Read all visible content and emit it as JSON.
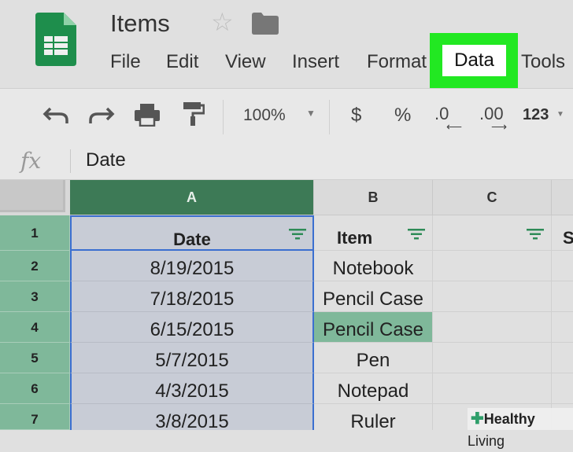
{
  "doc": {
    "title": "Items"
  },
  "menu": [
    "File",
    "Edit",
    "View",
    "Insert",
    "Format",
    "Data",
    "Tools"
  ],
  "toolbar": {
    "zoom": "100%",
    "currency": "$",
    "percent": "%",
    "dec_decrease": ".0",
    "dec_increase": ".00",
    "format_more": "123"
  },
  "formula_bar": {
    "fx": "fx",
    "value": "Date"
  },
  "columns": [
    "A",
    "B",
    "C"
  ],
  "rows": [
    "1",
    "2",
    "3",
    "4",
    "5",
    "6",
    "7"
  ],
  "headers": {
    "a": "Date",
    "b": "Item",
    "d_partial": "S"
  },
  "data": [
    {
      "date": "8/19/2015",
      "item": "Notebook"
    },
    {
      "date": "7/18/2015",
      "item": "Pencil Case"
    },
    {
      "date": "6/15/2015",
      "item": "Pencil Case"
    },
    {
      "date": "5/7/2015",
      "item": "Pen"
    },
    {
      "date": "4/3/2015",
      "item": "Notepad"
    },
    {
      "date": "3/8/2015",
      "item": "Ruler"
    }
  ],
  "watermark": {
    "brand": "Healthy",
    "brand2": "Living"
  },
  "colors": {
    "active_col_header": "#3d7a56",
    "row_header": "#7fb89a",
    "highlight": "#22e822",
    "selected_cell": "#7fb89a"
  },
  "icons": [
    "sheets-logo-icon",
    "star-icon",
    "folder-icon",
    "undo-icon",
    "redo-icon",
    "print-icon",
    "paint-format-icon",
    "filter-icon",
    "dropdown-arrow-icon"
  ]
}
